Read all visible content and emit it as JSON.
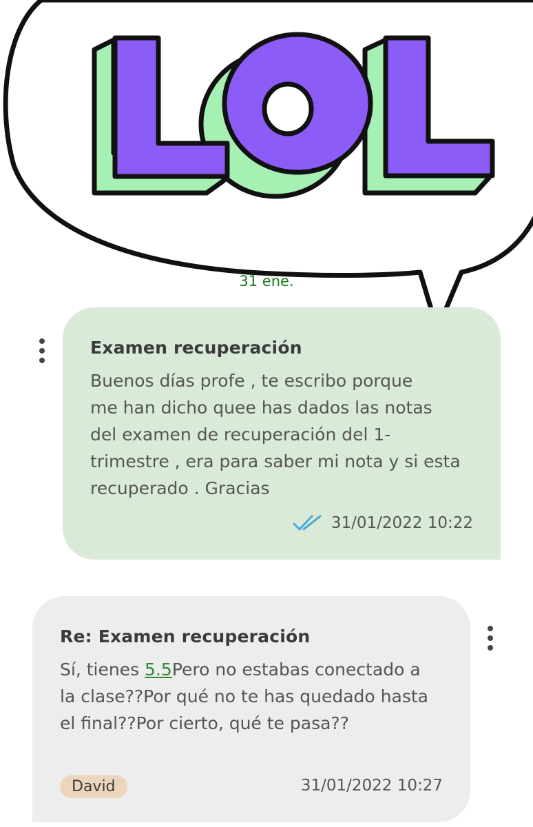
{
  "overlay": {
    "lettering": "LOL",
    "colors": {
      "fill": "#8b5cf6",
      "shadow": "#a6f0b4",
      "outline": "#111111"
    }
  },
  "date_separator": "31 ene.",
  "messages": [
    {
      "direction": "sent",
      "subject": "Examen recuperación",
      "body": "Buenos días profe , te escribo porque\nme han dicho quee has dados las notas\ndel examen de recuperación del 1-\ntrimestre , era para saber mi nota y si esta\nrecuperado . Gracias",
      "status_icon": "double-check-icon",
      "timestamp": "31/01/2022 10:22",
      "menu_icon": "more-vertical-icon"
    },
    {
      "direction": "received",
      "subject": "Re: Examen recuperación",
      "body_prefix": "Sí, tienes ",
      "grade": "5.5",
      "body_suffix": "Pero no estabas conectado a\nla clase??Por qué no te has quedado hasta\nel final??Por cierto, qué te pasa??",
      "author": "David",
      "timestamp": "31/01/2022 10:27",
      "menu_icon": "more-vertical-icon"
    }
  ],
  "colors": {
    "sent_bubble": "#d9ead8",
    "received_bubble": "#ededed",
    "author_chip": "#ecd4bd",
    "date_separator": "#1a7a1a",
    "check_marks": "#4aa8d8",
    "grade_link": "#2f8a2f"
  }
}
